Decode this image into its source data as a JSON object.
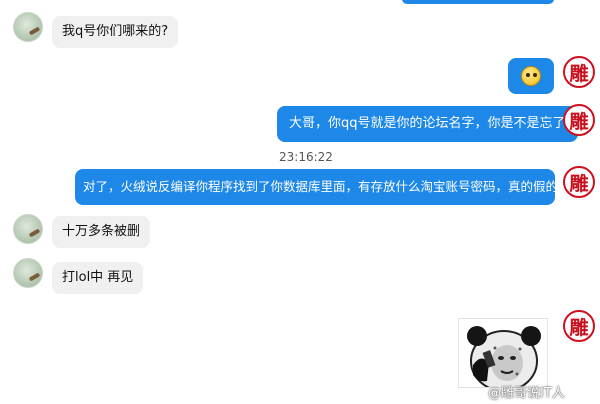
{
  "messages": [
    {
      "side": "left",
      "text": "我q号你们哪来的?"
    },
    {
      "side": "right",
      "type": "emoji"
    },
    {
      "side": "right",
      "text": "大哥，你qq号就是你的论坛名字，你是不是忘了"
    },
    {
      "timestamp": "23:16:22"
    },
    {
      "side": "right",
      "text": "对了，火绒说反编译你程序找到了你数据库里面，有存放什么淘宝账号密码，真的假的"
    },
    {
      "side": "left",
      "text": "十万多条被删"
    },
    {
      "side": "left",
      "text": "打lol中 再见"
    },
    {
      "side": "right",
      "type": "sticker"
    }
  ],
  "right_avatar_char": "雕",
  "watermark": "@雕哥说IT人",
  "colors": {
    "bubble_right": "#1e88e8",
    "bubble_left": "#f0f0f0",
    "avatar_ring": "#d10f1f"
  },
  "icons": {
    "left_avatar": "user-avatar-icon",
    "right_avatar": "diao-avatar-icon",
    "emoji": "smiley-emoji-icon",
    "sticker": "panda-meme-sticker"
  }
}
